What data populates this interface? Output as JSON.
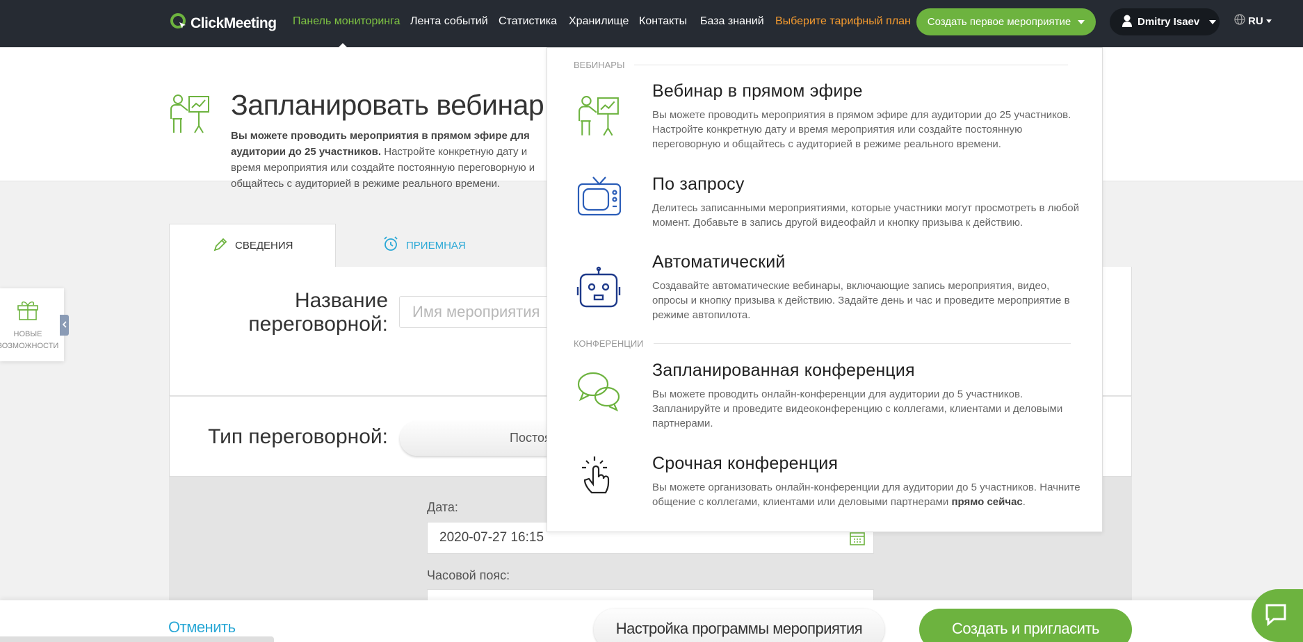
{
  "nav": {
    "logo": "ClickMeeting",
    "links": [
      "Панель мониторинга",
      "Лента событий",
      "Статистика",
      "Хранилище",
      "Контакты",
      "База знаний"
    ],
    "plan": "Выберите тарифный план",
    "create": "Создать первое мероприятие",
    "user": "Dmitry Isaev",
    "lang": "RU"
  },
  "header": {
    "title": "Запланировать вебинар",
    "desc_bold": "Вы можете проводить мероприятия в прямом эфире для аудитории до 25 участников.",
    "desc_rest": " Настройте конкретную дату и время мероприятия или создайте постоянную переговорную и общайтесь с аудиторией в режиме реального времени."
  },
  "tabs": [
    "СВЕДЕНИЯ",
    "ПРИЕМНАЯ"
  ],
  "form": {
    "name_label_1": "Название",
    "name_label_2": "переговорной:",
    "name_placeholder": "Имя мероприятия",
    "type_label": "Тип переговорной:",
    "type_value": "Постоя",
    "date_label": "Дата:",
    "date_value": "2020-07-27 16:15",
    "tz_label": "Часовой пояс:"
  },
  "bottom": {
    "cancel": "Отменить",
    "setup": "Настройка программы мероприятия",
    "invite": "Создать и пригласить"
  },
  "side_widget": {
    "line1": "НОВЫЕ",
    "line2": "ВОЗМОЖНОСТИ"
  },
  "dropdown": {
    "section_webinars": "ВЕБИНАРЫ",
    "section_conferences": "КОНФЕРЕНЦИИ",
    "items": [
      {
        "title": "Вебинар в прямом эфире",
        "desc": "Вы можете проводить мероприятия в прямом эфире для аудитории до 25 участников. Настройте конкретную дату и время мероприятия или создайте постоянную переговорную и общайтесь с аудиторией в режиме реального времени."
      },
      {
        "title": "По запросу",
        "desc": "Делитесь записанными мероприятиями, которые участники могут просмотреть в любой момент. Добавьте в запись другой видеофайл и кнопку призыва к действию."
      },
      {
        "title": "Автоматический",
        "desc": "Создавайте автоматические вебинары, включающие запись мероприятия, видео, опросы и кнопку призыва к действию. Задайте день и час и проведите мероприятие в режиме автопилота."
      },
      {
        "title": "Запланированная конференция",
        "desc": "Вы можете проводить онлайн-конференции для аудитории до 5 участников. Запланируйте и проведите видеоконференцию с коллегами, клиентами и деловыми партнерами."
      },
      {
        "title": "Срочная конференция",
        "desc": "Вы можете организовать онлайн-конференции для аудитории до 5 участников. Начните общение с коллегами, клиентами или деловыми партнерами ",
        "desc_bold": "прямо сейчас",
        "desc_end": "."
      }
    ]
  },
  "colors": {
    "nav_bg": "#262b33",
    "accent_green": "#6db33f",
    "link_blue": "#2aa8d6",
    "plan_orange": "#f39a2f"
  }
}
